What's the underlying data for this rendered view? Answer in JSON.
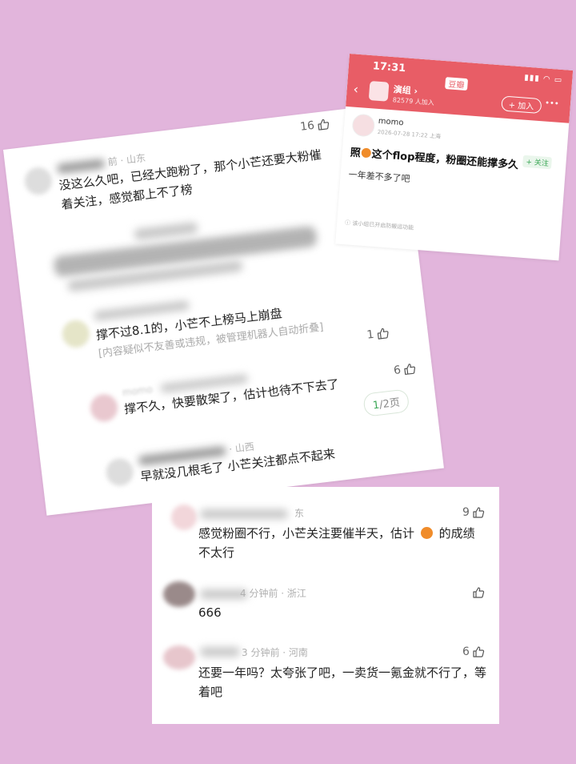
{
  "main_card": {
    "c1": {
      "meta": "前 · 山东",
      "text": "没这么久吧，已经大跑粉了，那个小芒还要大粉催着关注，感觉都上不了榜",
      "likes": "16"
    },
    "c3": {
      "text": "撑不过8.1的，小芒不上榜马上崩盘",
      "folded": "[内容疑似不友善或违规，被管理机器人自动折叠]",
      "likes": "1"
    },
    "c4": {
      "meta": "momo",
      "text": "撑不久，快要散架了，估计也待不下去了",
      "likes": "6"
    },
    "pager": {
      "current": "1",
      "total": "/2页"
    },
    "c5": {
      "meta": "· 山西",
      "text": "早就没几根毛了 小芒关注都点不起来"
    }
  },
  "phone": {
    "time": "17:31",
    "app": "豆瓣",
    "group_name": "演组 ›",
    "group_members": "82579 人加入",
    "join_button": "+ 加入",
    "more": "•••",
    "username": "momo",
    "post_time": "2026-07-28 17:22  上海",
    "follow": "+ 关注",
    "title": "这个flop程度，粉圈还能撑多久",
    "title_prefix": "照",
    "body": "一年差不多了吧",
    "notice": "ⓘ 该小组已开启防搬运功能"
  },
  "bottom_card": {
    "c1": {
      "meta": "东",
      "text_a": "感觉粉圈不行，小芒关注要催半天，估计",
      "text_b": "的成绩",
      "text_c": "不太行",
      "likes": "9"
    },
    "c2": {
      "meta": "4 分钟前 · 浙江",
      "text": "666"
    },
    "c3": {
      "meta": "3 分钟前 · 河南",
      "text": "还要一年吗？太夸张了吧，一卖货一氪金就不行了，等着吧",
      "likes": "6"
    }
  }
}
